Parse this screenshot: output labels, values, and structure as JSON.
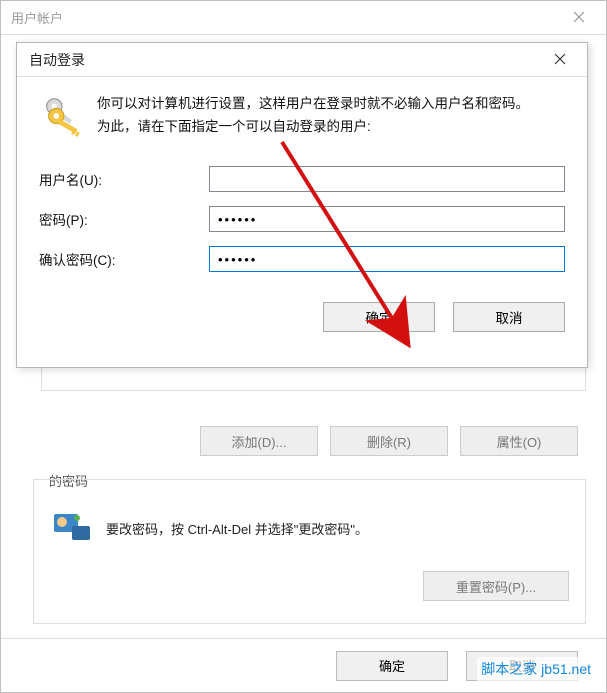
{
  "parent": {
    "title": "用户帐户",
    "buttons": {
      "add": "添加(D)...",
      "remove": "删除(R)",
      "properties": "属性(O)"
    },
    "pw_group_legend": "的密码",
    "pw_group_text": "要改密码，按 Ctrl-Alt-Del 并选择\"更改密码\"。",
    "reset_pw": "重置密码(P)...",
    "ok": "确定",
    "cancel": "取消"
  },
  "modal": {
    "title": "自动登录",
    "msg_line1": "你可以对计算机进行设置，这样用户在登录时就不必输入用户名和密码。",
    "msg_line2": "为此，请在下面指定一个可以自动登录的用户:",
    "username_label": "用户名(U):",
    "password_label": "密码(P):",
    "confirm_label": "确认密码(C):",
    "username_value": "",
    "password_value": "••••••",
    "confirm_value": "••••••",
    "ok": "确定",
    "cancel": "取消"
  },
  "watermark": "脚本之家 jb51.net"
}
